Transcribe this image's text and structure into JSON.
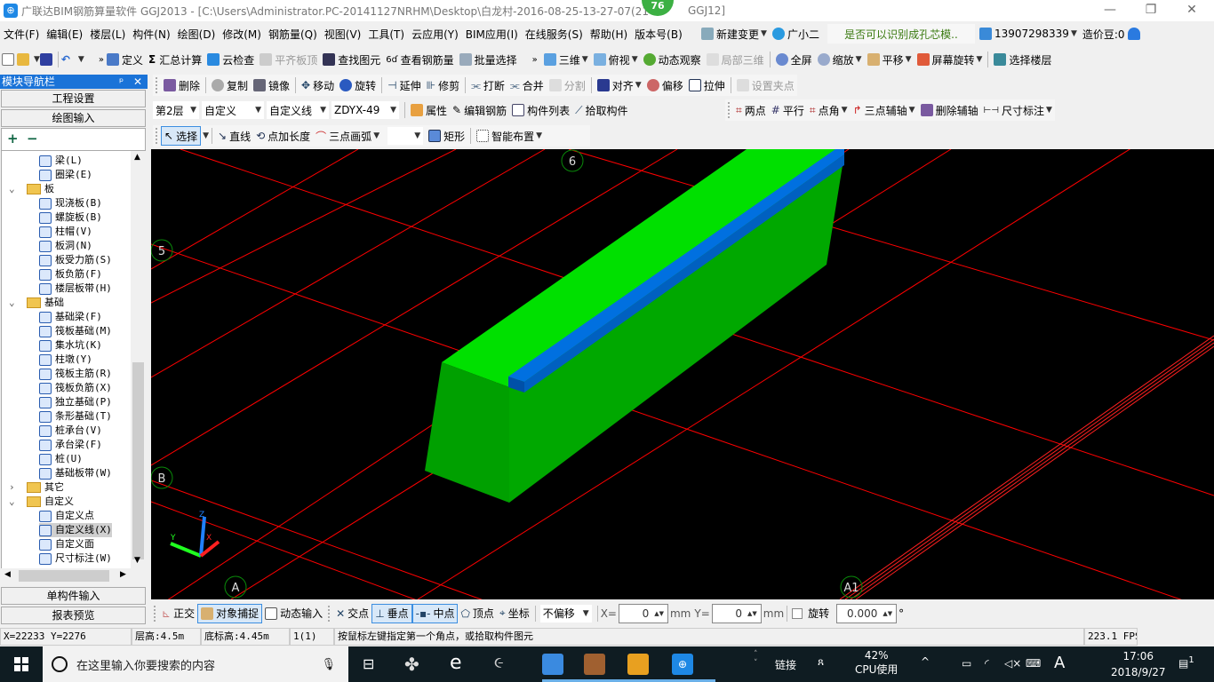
{
  "window": {
    "title": "广联达BIM钢筋算量软件 GGJ2013 - [C:\\Users\\Administrator.PC-20141127NRHM\\Desktop\\白龙村-2016-08-25-13-27-07(21",
    "title_tail": "GGJ12]",
    "badge": "76",
    "min": "—",
    "max": "❐",
    "close": "✕"
  },
  "menu": [
    "文件(F)",
    "编辑(E)",
    "楼层(L)",
    "构件(N)",
    "绘图(D)",
    "修改(M)",
    "钢筋量(Q)",
    "视图(V)",
    "工具(T)",
    "云应用(Y)",
    "BIM应用(I)",
    "在线服务(S)",
    "帮助(H)",
    "版本号(B)"
  ],
  "menu_right": {
    "new_change": "新建变更",
    "assistant": "广小二",
    "question": "是否可以识别成孔芯模..",
    "phone": "13907298339",
    "beans": "造价豆:0"
  },
  "toolbar1": {
    "define": "定义",
    "sum": "汇总计算",
    "cloud_check": "云检查",
    "align_slab": "平齐板顶",
    "find": "查找图元",
    "view_rebar": "查看钢筋量",
    "batch_select": "批量选择",
    "view3d": "三维",
    "top_view": "俯视",
    "dynamic": "动态观察",
    "local3d": "局部三维",
    "fullscreen": "全屏",
    "zoom": "缩放",
    "pan": "平移",
    "rotate_screen": "屏幕旋转",
    "select_floor": "选择楼层"
  },
  "toolbar2": {
    "delete": "删除",
    "copy": "复制",
    "mirror": "镜像",
    "move": "移动",
    "rotate": "旋转",
    "extend": "延伸",
    "trim": "修剪",
    "break": "打断",
    "merge": "合并",
    "split": "分割",
    "align": "对齐",
    "offset": "偏移",
    "stretch": "拉伸",
    "set_grip": "设置夹点"
  },
  "toolbar3": {
    "floor": "第2层",
    "type": "自定义",
    "subtype": "自定义线",
    "component": "ZDYX-49",
    "props": "属性",
    "edit_rebar": "编辑钢筋",
    "comp_list": "构件列表",
    "pick": "拾取构件",
    "two_point": "两点",
    "parallel": "平行",
    "point_angle": "点角",
    "three_point_axis": "三点辅轴",
    "del_axis": "删除辅轴",
    "dim": "尺寸标注"
  },
  "toolbar4": {
    "select": "选择",
    "line": "直线",
    "point_len": "点加长度",
    "arc": "三点画弧",
    "rect": "矩形",
    "smart": "智能布置"
  },
  "nav": {
    "title": "模块导航栏",
    "pin": "ᵖ",
    "close": "✕",
    "project": "工程设置",
    "drawing": "绘图输入",
    "single": "单构件输入",
    "report": "报表预览",
    "expand": "+",
    "collapse": "−"
  },
  "tree": [
    {
      "label": "梁(L)",
      "level": 2
    },
    {
      "label": "圈梁(E)",
      "level": 2
    },
    {
      "label": "板",
      "level": 1,
      "open": true
    },
    {
      "label": "现浇板(B)",
      "level": 2
    },
    {
      "label": "螺旋板(B)",
      "level": 2
    },
    {
      "label": "柱帽(V)",
      "level": 2
    },
    {
      "label": "板洞(N)",
      "level": 2
    },
    {
      "label": "板受力筋(S)",
      "level": 2
    },
    {
      "label": "板负筋(F)",
      "level": 2
    },
    {
      "label": "楼层板带(H)",
      "level": 2
    },
    {
      "label": "基础",
      "level": 1,
      "open": true
    },
    {
      "label": "基础梁(F)",
      "level": 2
    },
    {
      "label": "筏板基础(M)",
      "level": 2
    },
    {
      "label": "集水坑(K)",
      "level": 2
    },
    {
      "label": "柱墩(Y)",
      "level": 2
    },
    {
      "label": "筏板主筋(R)",
      "level": 2
    },
    {
      "label": "筏板负筋(X)",
      "level": 2
    },
    {
      "label": "独立基础(P)",
      "level": 2
    },
    {
      "label": "条形基础(T)",
      "level": 2
    },
    {
      "label": "桩承台(V)",
      "level": 2
    },
    {
      "label": "承台梁(F)",
      "level": 2
    },
    {
      "label": "桩(U)",
      "level": 2
    },
    {
      "label": "基础板带(W)",
      "level": 2
    },
    {
      "label": "其它",
      "level": 1,
      "open": false
    },
    {
      "label": "自定义",
      "level": 1,
      "open": true
    },
    {
      "label": "自定义点",
      "level": 2
    },
    {
      "label": "自定义线(X)",
      "level": 2,
      "selected": true
    },
    {
      "label": "自定义面",
      "level": 2
    },
    {
      "label": "尺寸标注(W)",
      "level": 2
    }
  ],
  "viewport": {
    "axis_labels": [
      "6",
      "5",
      "B",
      "A",
      "A1"
    ],
    "gizmo": {
      "x": "X",
      "y": "Y",
      "z": "Z"
    },
    "colors": {
      "beam": "#00e000",
      "beam_side": "#00a000",
      "strip": "#0070e0",
      "grid": "#ff0000",
      "bubble": "#0a8a0a"
    }
  },
  "snap": {
    "ortho": "正交",
    "object_snap": "对象捕捉",
    "dynamic_input": "动态输入",
    "intersection": "交点",
    "perpendicular": "垂点",
    "midpoint": "中点",
    "vertex": "顶点",
    "coordinate": "坐标",
    "offset_mode": "不偏移",
    "x_label": "X=",
    "x_value": "0",
    "mm1": "mm",
    "y_label": "Y=",
    "y_value": "0",
    "mm2": "mm",
    "rotate_label": "旋转",
    "rotate_value": "0.000",
    "degree": "°"
  },
  "status": {
    "coords": "X=22233 Y=2276",
    "floor_height": "层高:4.5m",
    "bottom_elev": "底标高:4.45m",
    "count": "1(1)",
    "hint": "按鼠标左键指定第一个角点，或拾取构件图元",
    "fps": "223.1 FPS"
  },
  "taskbar": {
    "search_placeholder": "在这里输入你要搜索的内容",
    "link": "链接",
    "cpu_pct": "42%",
    "cpu_label": "CPU使用",
    "ime": "A",
    "time": "17:06",
    "date": "2018/9/27",
    "notif": "1"
  }
}
